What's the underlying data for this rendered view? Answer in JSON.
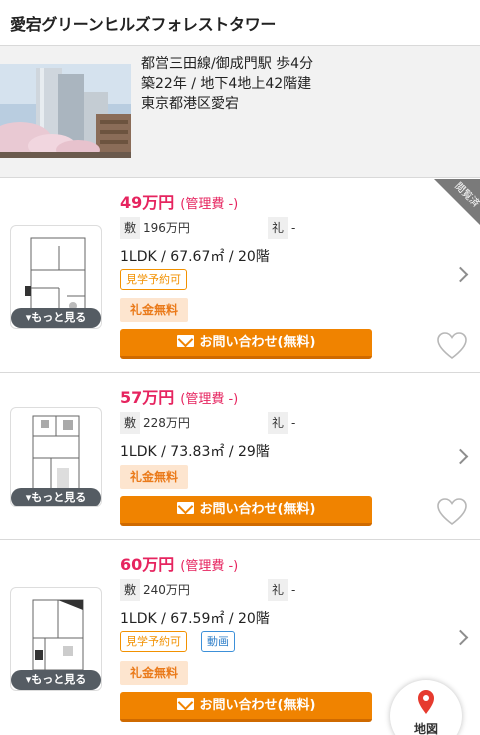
{
  "header": {
    "title": "愛宕グリーンヒルズフォレストタワー"
  },
  "building": {
    "access": "都営三田線/御成門駅 歩4分",
    "age_floors": "築22年 / 地下4地上42階建",
    "address": "東京都港区愛宕"
  },
  "labels": {
    "deposit_tag": "敷",
    "key_money_tag": "礼",
    "more": "▾もっと見る",
    "contact": "お問い合わせ(無料)",
    "viewed": "閲覧済",
    "map": "地図"
  },
  "listings": [
    {
      "rent": "49万円",
      "mgmt": "(管理費 -)",
      "deposit": "196万円",
      "key_money": "-",
      "spec": "1LDK / 67.67㎡ / 20階",
      "tags": [
        "見学予約可"
      ],
      "badge": "礼金無料",
      "viewed": true
    },
    {
      "rent": "57万円",
      "mgmt": "(管理費 -)",
      "deposit": "228万円",
      "key_money": "-",
      "spec": "1LDK / 73.83㎡ / 29階",
      "tags": [],
      "badge": "礼金無料",
      "viewed": false
    },
    {
      "rent": "60万円",
      "mgmt": "(管理費 -)",
      "deposit": "240万円",
      "key_money": "-",
      "spec": "1LDK / 67.59㎡ / 20階",
      "tags": [
        "見学予約可",
        "動画"
      ],
      "badge": "礼金無料",
      "viewed": false
    }
  ],
  "colors": {
    "price": "#e6245f",
    "cta": "#f08300",
    "tag_orange": "#f29100",
    "tag_blue": "#2f7fc9",
    "map_pin": "#e63a2e"
  }
}
